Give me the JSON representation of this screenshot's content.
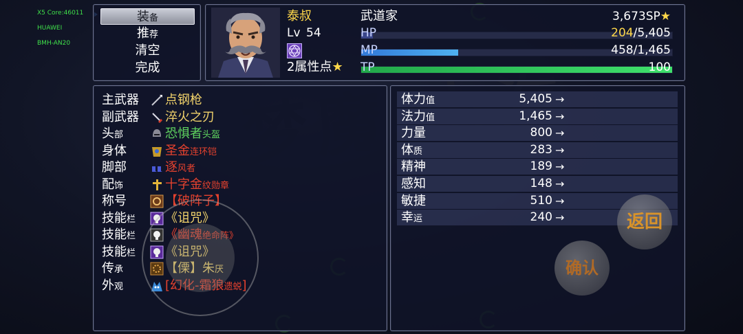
{
  "device_info": [
    "X5 Core:46011",
    "HUAWEI",
    "BMH-AN20"
  ],
  "command_menu": [
    {
      "label": "装",
      "sub": "备"
    },
    {
      "label": "推",
      "sub": "荐"
    },
    {
      "label": "清空",
      "sub": ""
    },
    {
      "label": "完成",
      "sub": ""
    }
  ],
  "actor": {
    "name": "泰叔",
    "level_label": "Lv",
    "level": "54",
    "class": "武道家",
    "sp": "3,673",
    "sp_unit": "SP",
    "attribute_points": "2属性点",
    "hp_label": "HP",
    "hp_current": "204",
    "hp_max": "/5,405",
    "hp_ratio": 0.0377,
    "mp_label": "MP",
    "mp_current": "458/1,465",
    "mp_ratio": 0.3126,
    "tp_label": "TP",
    "tp_value": "100",
    "tp_ratio": 1.0
  },
  "equipment": [
    {
      "slot": "主武器",
      "slot_sub": "",
      "icon": "spear-icon",
      "name": "点钢枪",
      "name_sub": "",
      "color": "#f2d36b"
    },
    {
      "slot": "副武器",
      "slot_sub": "",
      "icon": "sword-icon",
      "name": "淬火之刃",
      "name_sub": "",
      "color": "#f2d36b"
    },
    {
      "slot": "头",
      "slot_sub": "部",
      "icon": "helmet-icon",
      "name": "恐惧者",
      "name_sub": "头盔",
      "color": "#5fd35f"
    },
    {
      "slot": "身体",
      "slot_sub": "",
      "icon": "chainmail-icon",
      "name": "圣金",
      "name_sub": "连环铠",
      "color": "#e5422e"
    },
    {
      "slot": "脚部",
      "slot_sub": "",
      "icon": "boots-icon",
      "name": "逐",
      "name_sub": "风者",
      "color": "#e5422e"
    },
    {
      "slot": "配",
      "slot_sub": "饰",
      "icon": "cross-icon",
      "name": "十字金",
      "name_sub": "纹勋章",
      "color": "#e5422e"
    },
    {
      "slot": "称号",
      "slot_sub": "",
      "icon": "title-emblem-icon",
      "name": "【破阵子】",
      "name_sub": "",
      "color": "#e5422e"
    },
    {
      "slot": "技能",
      "slot_sub": "栏",
      "icon": "skull-purple-icon",
      "name": "《诅咒》",
      "name_sub": "",
      "color": "#f2d36b"
    },
    {
      "slot": "技能",
      "slot_sub": "栏",
      "icon": "skull-white-icon",
      "name": "《幽魂",
      "name_sub": "绝命阵》",
      "color": "#e5422e"
    },
    {
      "slot": "技能",
      "slot_sub": "栏",
      "icon": "skull-purple-icon",
      "name": "《诅咒》",
      "name_sub": "",
      "color": "#f2d36b"
    },
    {
      "slot": "传",
      "slot_sub": "承",
      "icon": "inherit-gear-icon",
      "name": "【",
      "name_sub": "",
      "name2": "傈】朱",
      "name2_sub": "厌",
      "color": "#f2d36b"
    },
    {
      "slot": "外",
      "slot_sub": "观",
      "icon": "wolf-icon",
      "name": "[幻化-霜狼",
      "name_sub": "遗蜕",
      "name2": "]",
      "name2_sub": "",
      "color": "#e5422e"
    }
  ],
  "params": [
    {
      "name": "体力",
      "sub": "值",
      "value": "5,405",
      "arrow": "→"
    },
    {
      "name": "法力",
      "sub": "值",
      "value": "1,465",
      "arrow": "→"
    },
    {
      "name": "力量",
      "sub": "",
      "value": "800",
      "arrow": "→"
    },
    {
      "name": "体",
      "sub": "质",
      "value": "283",
      "arrow": "→"
    },
    {
      "name": "精神",
      "sub": "",
      "value": "189",
      "arrow": "→"
    },
    {
      "name": "感知",
      "sub": "",
      "value": "148",
      "arrow": "→"
    },
    {
      "name": "敏捷",
      "sub": "",
      "value": "510",
      "arrow": "→"
    },
    {
      "name": "幸",
      "sub": "运",
      "value": "240",
      "arrow": "→"
    }
  ],
  "buttons": {
    "back": "返回",
    "confirm": "确认"
  },
  "colors": {
    "hp_gauge": "#2e3a78",
    "mp_gauge": "#3f9fe6",
    "tp_gauge": "#2fc25a",
    "hp_low": "#ffd84a",
    "actor_name": "#ffd84a",
    "window_border": "#6c7290"
  }
}
